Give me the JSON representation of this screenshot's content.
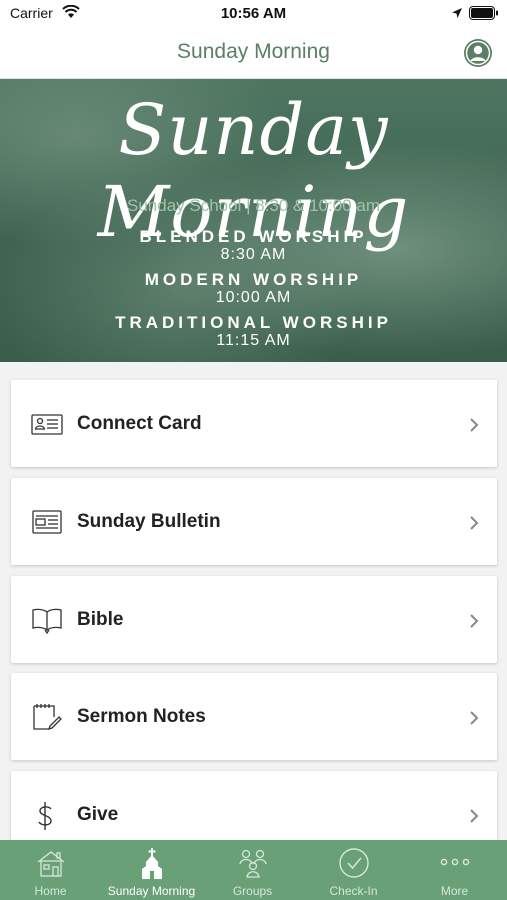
{
  "status_bar": {
    "carrier": "Carrier",
    "time": "10:56 AM"
  },
  "nav": {
    "title": "Sunday Morning"
  },
  "banner": {
    "script_title": "Sunday Morning",
    "subtitle": "Sunday School  |  8:30 & 10:00 am",
    "services": [
      {
        "name": "BLENDED WORSHIP",
        "time": "8:30 AM"
      },
      {
        "name": "MODERN WORSHIP",
        "time": "10:00 AM"
      },
      {
        "name": "TRADITIONAL WORSHIP",
        "time": "11:15 AM"
      }
    ]
  },
  "menu": [
    {
      "label": "Connect Card",
      "icon": "id-card-icon"
    },
    {
      "label": "Sunday Bulletin",
      "icon": "newspaper-icon"
    },
    {
      "label": "Bible",
      "icon": "book-icon"
    },
    {
      "label": "Sermon Notes",
      "icon": "notepad-pencil-icon"
    },
    {
      "label": "Give",
      "icon": "dollar-icon"
    }
  ],
  "tabs": [
    {
      "label": "Home",
      "icon": "house-icon"
    },
    {
      "label": "Sunday Morning",
      "icon": "church-icon",
      "active": true
    },
    {
      "label": "Groups",
      "icon": "group-icon"
    },
    {
      "label": "Check-In",
      "icon": "check-circle-icon"
    },
    {
      "label": "More",
      "icon": "more-icon"
    }
  ],
  "colors": {
    "brand_green": "#6aa077",
    "title_green": "#5b7f64"
  }
}
